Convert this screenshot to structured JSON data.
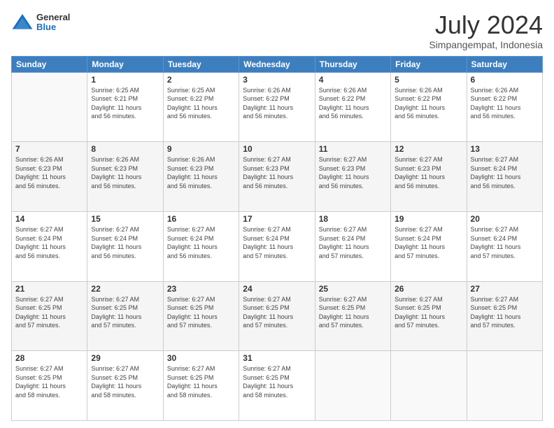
{
  "header": {
    "logo": {
      "general": "General",
      "blue": "Blue"
    },
    "title": "July 2024",
    "subtitle": "Simpangempat, Indonesia"
  },
  "calendar": {
    "days_of_week": [
      "Sunday",
      "Monday",
      "Tuesday",
      "Wednesday",
      "Thursday",
      "Friday",
      "Saturday"
    ],
    "weeks": [
      [
        {
          "day": "",
          "info": ""
        },
        {
          "day": "1",
          "info": "Sunrise: 6:25 AM\nSunset: 6:21 PM\nDaylight: 11 hours\nand 56 minutes."
        },
        {
          "day": "2",
          "info": "Sunrise: 6:25 AM\nSunset: 6:22 PM\nDaylight: 11 hours\nand 56 minutes."
        },
        {
          "day": "3",
          "info": "Sunrise: 6:26 AM\nSunset: 6:22 PM\nDaylight: 11 hours\nand 56 minutes."
        },
        {
          "day": "4",
          "info": "Sunrise: 6:26 AM\nSunset: 6:22 PM\nDaylight: 11 hours\nand 56 minutes."
        },
        {
          "day": "5",
          "info": "Sunrise: 6:26 AM\nSunset: 6:22 PM\nDaylight: 11 hours\nand 56 minutes."
        },
        {
          "day": "6",
          "info": "Sunrise: 6:26 AM\nSunset: 6:22 PM\nDaylight: 11 hours\nand 56 minutes."
        }
      ],
      [
        {
          "day": "7",
          "info": "Sunrise: 6:26 AM\nSunset: 6:23 PM\nDaylight: 11 hours\nand 56 minutes."
        },
        {
          "day": "8",
          "info": "Sunrise: 6:26 AM\nSunset: 6:23 PM\nDaylight: 11 hours\nand 56 minutes."
        },
        {
          "day": "9",
          "info": "Sunrise: 6:26 AM\nSunset: 6:23 PM\nDaylight: 11 hours\nand 56 minutes."
        },
        {
          "day": "10",
          "info": "Sunrise: 6:27 AM\nSunset: 6:23 PM\nDaylight: 11 hours\nand 56 minutes."
        },
        {
          "day": "11",
          "info": "Sunrise: 6:27 AM\nSunset: 6:23 PM\nDaylight: 11 hours\nand 56 minutes."
        },
        {
          "day": "12",
          "info": "Sunrise: 6:27 AM\nSunset: 6:23 PM\nDaylight: 11 hours\nand 56 minutes."
        },
        {
          "day": "13",
          "info": "Sunrise: 6:27 AM\nSunset: 6:24 PM\nDaylight: 11 hours\nand 56 minutes."
        }
      ],
      [
        {
          "day": "14",
          "info": "Sunrise: 6:27 AM\nSunset: 6:24 PM\nDaylight: 11 hours\nand 56 minutes."
        },
        {
          "day": "15",
          "info": "Sunrise: 6:27 AM\nSunset: 6:24 PM\nDaylight: 11 hours\nand 56 minutes."
        },
        {
          "day": "16",
          "info": "Sunrise: 6:27 AM\nSunset: 6:24 PM\nDaylight: 11 hours\nand 56 minutes."
        },
        {
          "day": "17",
          "info": "Sunrise: 6:27 AM\nSunset: 6:24 PM\nDaylight: 11 hours\nand 57 minutes."
        },
        {
          "day": "18",
          "info": "Sunrise: 6:27 AM\nSunset: 6:24 PM\nDaylight: 11 hours\nand 57 minutes."
        },
        {
          "day": "19",
          "info": "Sunrise: 6:27 AM\nSunset: 6:24 PM\nDaylight: 11 hours\nand 57 minutes."
        },
        {
          "day": "20",
          "info": "Sunrise: 6:27 AM\nSunset: 6:24 PM\nDaylight: 11 hours\nand 57 minutes."
        }
      ],
      [
        {
          "day": "21",
          "info": "Sunrise: 6:27 AM\nSunset: 6:25 PM\nDaylight: 11 hours\nand 57 minutes."
        },
        {
          "day": "22",
          "info": "Sunrise: 6:27 AM\nSunset: 6:25 PM\nDaylight: 11 hours\nand 57 minutes."
        },
        {
          "day": "23",
          "info": "Sunrise: 6:27 AM\nSunset: 6:25 PM\nDaylight: 11 hours\nand 57 minutes."
        },
        {
          "day": "24",
          "info": "Sunrise: 6:27 AM\nSunset: 6:25 PM\nDaylight: 11 hours\nand 57 minutes."
        },
        {
          "day": "25",
          "info": "Sunrise: 6:27 AM\nSunset: 6:25 PM\nDaylight: 11 hours\nand 57 minutes."
        },
        {
          "day": "26",
          "info": "Sunrise: 6:27 AM\nSunset: 6:25 PM\nDaylight: 11 hours\nand 57 minutes."
        },
        {
          "day": "27",
          "info": "Sunrise: 6:27 AM\nSunset: 6:25 PM\nDaylight: 11 hours\nand 57 minutes."
        }
      ],
      [
        {
          "day": "28",
          "info": "Sunrise: 6:27 AM\nSunset: 6:25 PM\nDaylight: 11 hours\nand 58 minutes."
        },
        {
          "day": "29",
          "info": "Sunrise: 6:27 AM\nSunset: 6:25 PM\nDaylight: 11 hours\nand 58 minutes."
        },
        {
          "day": "30",
          "info": "Sunrise: 6:27 AM\nSunset: 6:25 PM\nDaylight: 11 hours\nand 58 minutes."
        },
        {
          "day": "31",
          "info": "Sunrise: 6:27 AM\nSunset: 6:25 PM\nDaylight: 11 hours\nand 58 minutes."
        },
        {
          "day": "",
          "info": ""
        },
        {
          "day": "",
          "info": ""
        },
        {
          "day": "",
          "info": ""
        }
      ]
    ]
  }
}
